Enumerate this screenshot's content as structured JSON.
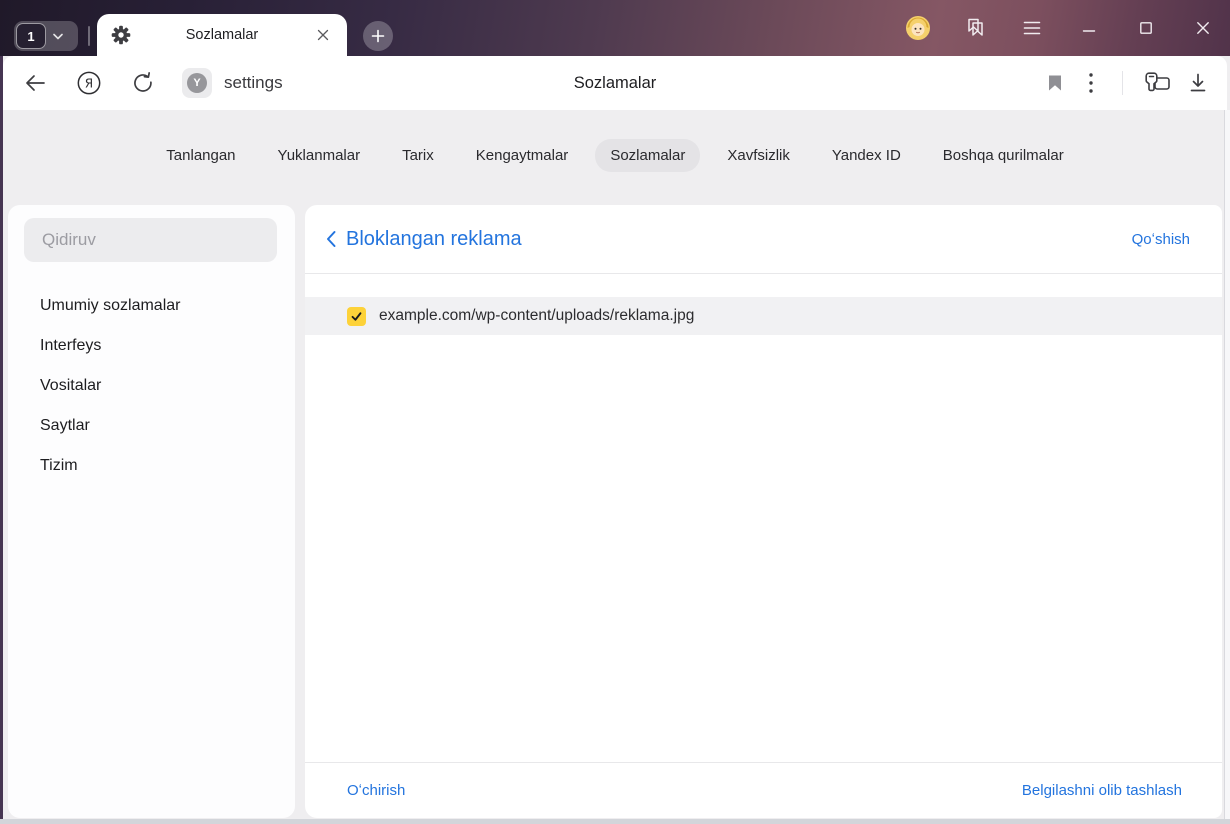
{
  "window": {
    "tab_group_count": "1",
    "tab_title": "Sozlamalar"
  },
  "toolbar": {
    "address": "settings",
    "page_title": "Sozlamalar"
  },
  "nav": {
    "items": [
      {
        "label": "Tanlangan",
        "active": false
      },
      {
        "label": "Yuklanmalar",
        "active": false
      },
      {
        "label": "Tarix",
        "active": false
      },
      {
        "label": "Kengaytmalar",
        "active": false
      },
      {
        "label": "Sozlamalar",
        "active": true
      },
      {
        "label": "Xavfsizlik",
        "active": false
      },
      {
        "label": "Yandex ID",
        "active": false
      },
      {
        "label": "Boshqa qurilmalar",
        "active": false
      }
    ]
  },
  "sidebar": {
    "search_placeholder": "Qidiruv",
    "items": [
      {
        "label": "Umumiy sozlamalar"
      },
      {
        "label": "Interfeys"
      },
      {
        "label": "Vositalar"
      },
      {
        "label": "Saytlar"
      },
      {
        "label": "Tizim"
      }
    ]
  },
  "content": {
    "heading": "Bloklangan reklama",
    "add_label": "Qoʻshish",
    "rows": [
      {
        "url": "example.com/wp-content/uploads/reklama.jpg",
        "checked": true
      }
    ],
    "footer": {
      "delete_label": "Oʻchirish",
      "clear_selection_label": "Belgilashni olib tashlash"
    }
  },
  "colors": {
    "accent_blue": "#2374de",
    "checkbox_yellow": "#fdd239",
    "active_pill": "#e4e3e6"
  }
}
